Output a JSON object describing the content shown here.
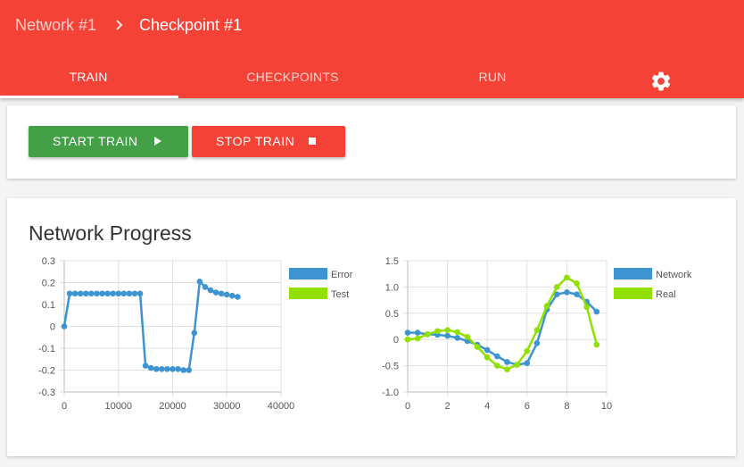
{
  "breadcrumb": {
    "root": "Network #1",
    "current": "Checkpoint #1"
  },
  "tabs": [
    {
      "label": "TRAIN",
      "active": true
    },
    {
      "label": "CHECKPOINTS",
      "active": false
    },
    {
      "label": "RUN",
      "active": false
    }
  ],
  "settings_icon": "gear-icon",
  "controls": {
    "start_label": "START TRAIN",
    "stop_label": "STOP TRAIN"
  },
  "progress": {
    "title": "Network Progress"
  },
  "colors": {
    "appbar": "#f44336",
    "start_button": "#43a047",
    "stop_button": "#f44336",
    "series_blue": "#3d94d0",
    "series_green": "#91e000"
  },
  "chart_data": [
    {
      "type": "line",
      "grid": true,
      "legend_position": "right",
      "xlim": [
        0,
        40000
      ],
      "ylim": [
        -0.3,
        0.3
      ],
      "x_ticks": [
        0,
        10000,
        20000,
        30000,
        40000
      ],
      "y_ticks": [
        0.3,
        0.2,
        0.1,
        0,
        -0.1,
        -0.2,
        -0.3
      ],
      "series": [
        {
          "name": "Error",
          "color": "#3d94d0",
          "points": [
            [
              0,
              0
            ],
            [
              1000,
              0.15
            ],
            [
              2000,
              0.15
            ],
            [
              3000,
              0.15
            ],
            [
              4000,
              0.15
            ],
            [
              5000,
              0.15
            ],
            [
              6000,
              0.15
            ],
            [
              7000,
              0.15
            ],
            [
              8000,
              0.15
            ],
            [
              9000,
              0.15
            ],
            [
              10000,
              0.15
            ],
            [
              11000,
              0.15
            ],
            [
              12000,
              0.15
            ],
            [
              13000,
              0.15
            ],
            [
              14000,
              0.15
            ],
            [
              15000,
              -0.18
            ],
            [
              16000,
              -0.19
            ],
            [
              17000,
              -0.195
            ],
            [
              18000,
              -0.195
            ],
            [
              19000,
              -0.195
            ],
            [
              20000,
              -0.195
            ],
            [
              21000,
              -0.195
            ],
            [
              22000,
              -0.2
            ],
            [
              23000,
              -0.2
            ],
            [
              24000,
              -0.03
            ],
            [
              25000,
              0.205
            ],
            [
              26000,
              0.18
            ],
            [
              27000,
              0.165
            ],
            [
              28000,
              0.155
            ],
            [
              29000,
              0.15
            ],
            [
              30000,
              0.145
            ],
            [
              31000,
              0.14
            ],
            [
              32000,
              0.135
            ]
          ]
        },
        {
          "name": "Test",
          "color": "#91e000",
          "points": []
        }
      ]
    },
    {
      "type": "line",
      "grid": true,
      "legend_position": "right",
      "xlim": [
        0,
        10
      ],
      "ylim": [
        -1.0,
        1.5
      ],
      "x_ticks": [
        0,
        2,
        4,
        6,
        8,
        10
      ],
      "y_ticks": [
        1.5,
        1.0,
        0.5,
        0,
        -0.5,
        -1.0
      ],
      "y_tick_labels": [
        "1.5",
        "1.0",
        "0.5",
        "0",
        "-0.5",
        "-1.0"
      ],
      "series": [
        {
          "name": "Network",
          "color": "#3d94d0",
          "points": [
            [
              0,
              0.13
            ],
            [
              0.5,
              0.13
            ],
            [
              1,
              0.1
            ],
            [
              1.5,
              0.09
            ],
            [
              2,
              0.07
            ],
            [
              2.5,
              0.03
            ],
            [
              3,
              -0.03
            ],
            [
              3.5,
              -0.1
            ],
            [
              4,
              -0.2
            ],
            [
              4.5,
              -0.32
            ],
            [
              5,
              -0.43
            ],
            [
              5.5,
              -0.48
            ],
            [
              6,
              -0.45
            ],
            [
              6.5,
              -0.07
            ],
            [
              7,
              0.57
            ],
            [
              7.5,
              0.86
            ],
            [
              8,
              0.9
            ],
            [
              8.5,
              0.86
            ],
            [
              9,
              0.72
            ],
            [
              9.5,
              0.53
            ]
          ]
        },
        {
          "name": "Real",
          "color": "#91e000",
          "points": [
            [
              0,
              0
            ],
            [
              0.5,
              0.02
            ],
            [
              1,
              0.1
            ],
            [
              1.5,
              0.16
            ],
            [
              2,
              0.18
            ],
            [
              2.5,
              0.14
            ],
            [
              3,
              0.05
            ],
            [
              3.5,
              -0.14
            ],
            [
              4,
              -0.34
            ],
            [
              4.5,
              -0.5
            ],
            [
              5,
              -0.57
            ],
            [
              5.5,
              -0.48
            ],
            [
              6,
              -0.22
            ],
            [
              6.5,
              0.18
            ],
            [
              7,
              0.64
            ],
            [
              7.5,
              1.0
            ],
            [
              8,
              1.18
            ],
            [
              8.5,
              1.07
            ],
            [
              9,
              0.62
            ],
            [
              9.5,
              -0.1
            ]
          ]
        }
      ]
    }
  ]
}
